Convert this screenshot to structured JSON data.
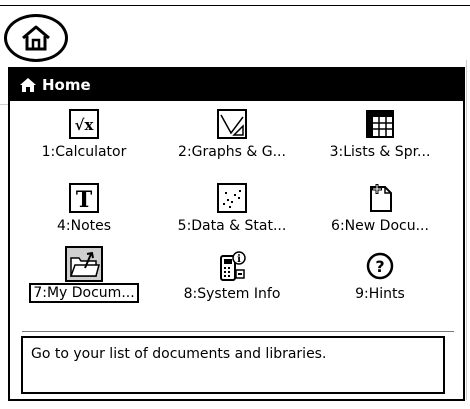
{
  "window": {
    "title": "Home",
    "hint_text": "Go to your list of documents and libraries."
  },
  "menu": {
    "items": [
      {
        "label": "1:Calculator",
        "icon": "calculator-icon"
      },
      {
        "label": "2:Graphs & G...",
        "icon": "graphs-icon"
      },
      {
        "label": "3:Lists & Spr...",
        "icon": "spreadsheet-icon"
      },
      {
        "label": "4:Notes",
        "icon": "notes-icon"
      },
      {
        "label": "5:Data & Stat...",
        "icon": "data-stats-icon"
      },
      {
        "label": "6:New Docu...",
        "icon": "new-document-icon"
      },
      {
        "label": "7:My Docum...",
        "icon": "my-documents-icon",
        "selected": true
      },
      {
        "label": "8:System Info",
        "icon": "system-info-icon"
      },
      {
        "label": "9:Hints",
        "icon": "hints-icon"
      }
    ]
  },
  "colors": {
    "titlebar": "#000000",
    "selection_fill": "#cfcfcf"
  }
}
